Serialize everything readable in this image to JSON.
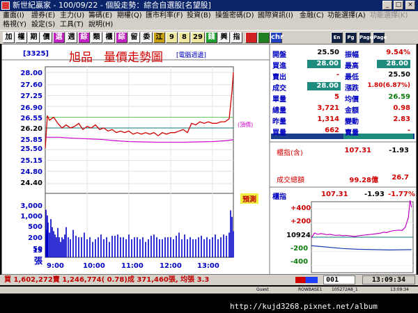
{
  "window": {
    "title": "新世紀贏家 - 100/09/22 - 個股走勢：綜合自選股[名望股]",
    "controls": [
      "_",
      "□",
      "×"
    ]
  },
  "menu": {
    "row1": [
      "畫面(I)",
      "證券(E)",
      "主力(U)",
      "籌碼(E)",
      "期權(Q)",
      "匯市利率(F)",
      "投資(B)",
      "操盤密碼(D)",
      "國際資訊(I)",
      "金融(C)",
      "功能選擇(A)",
      "功能選擇(K)"
    ],
    "row2": [
      "格視(Y)",
      "設定(S)",
      "工具(T)",
      "說明(H)"
    ]
  },
  "toolbar": {
    "buttons": [
      "加",
      "權",
      "期",
      "價",
      "選",
      "週",
      "綜",
      "類",
      "櫃",
      "綜",
      "留",
      "委",
      "江",
      "9",
      "8",
      "29",
      "錢",
      "興",
      "指",
      "",
      "",
      "chr",
      "En",
      "Pg",
      "Page",
      "Page"
    ]
  },
  "stock": {
    "code": "[3325]",
    "name": "旭品",
    "chart_title": "量價走勢圖",
    "tag": "[電腦週邊]",
    "annotation": "(頂價)",
    "volume_badge": "預測",
    "volume_unit": "張"
  },
  "chart_data": {
    "type": "line",
    "price_ticks": [
      "28.00",
      "27.60",
      "27.25",
      "26.90",
      "26.55",
      "26.20",
      "25.85",
      "25.50",
      "25.15",
      "24.80",
      "24.40"
    ],
    "volume_ticks": [
      "3,000",
      "1,000",
      "500",
      "200",
      "50",
      "15"
    ],
    "time_labels": [
      "9:00",
      "10:00",
      "11:00",
      "12:00",
      "13:00"
    ],
    "reference_price": 26.2,
    "limit_up": 28.0,
    "ylim": [
      24.4,
      28.0
    ],
    "price_series": {
      "x": [
        0,
        3,
        6,
        9,
        12,
        18,
        24,
        30,
        36,
        42,
        48,
        54,
        60,
        66,
        72,
        78,
        84,
        90,
        96,
        102,
        108,
        114,
        120,
        126,
        132,
        138,
        144,
        150,
        156,
        162,
        168,
        174,
        180,
        186,
        192,
        198,
        204,
        210,
        216,
        222,
        228,
        234,
        240,
        246,
        252,
        258,
        264,
        268,
        270
      ],
      "y": [
        25.55,
        26.6,
        26.45,
        26.5,
        26.55,
        26.35,
        26.2,
        26.3,
        26.2,
        26.25,
        26.35,
        26.15,
        26.25,
        26.2,
        26.3,
        26.15,
        26.2,
        26.1,
        26.15,
        26.05,
        26.1,
        26.05,
        26.1,
        26.0,
        26.05,
        26.0,
        26.05,
        26.0,
        26.05,
        25.95,
        26.05,
        26.0,
        26.05,
        26.05,
        26.1,
        26.15,
        26.05,
        26.35,
        26.3,
        26.4,
        26.35,
        26.4,
        26.35,
        26.35,
        26.4,
        26.4,
        26.5,
        27.4,
        28.0
      ]
    },
    "avg_series": {
      "x": [
        0,
        20,
        40,
        60,
        80,
        100,
        120,
        140,
        160,
        180,
        200,
        220,
        240,
        260,
        270
      ],
      "y": [
        25.9,
        25.9,
        25.87,
        25.85,
        25.83,
        25.79,
        25.76,
        25.75,
        25.74,
        25.74,
        25.74,
        25.75,
        25.76,
        25.79,
        25.82
      ]
    },
    "volume_series": {
      "x": [
        1,
        2,
        3,
        4,
        6,
        8,
        10,
        12,
        14,
        16,
        18,
        20,
        22,
        24,
        26,
        28,
        30,
        33,
        36,
        40,
        44,
        48,
        52,
        56,
        60,
        64,
        68,
        72,
        76,
        80,
        84,
        88,
        92,
        96,
        100,
        104,
        108,
        112,
        116,
        120,
        124,
        128,
        132,
        136,
        140,
        144,
        148,
        152,
        156,
        160,
        164,
        168,
        172,
        176,
        180,
        184,
        188,
        192,
        196,
        200,
        204,
        208,
        212,
        216,
        220,
        224,
        228,
        232,
        236,
        240,
        244,
        248,
        252,
        256,
        260,
        264,
        266,
        268,
        270
      ],
      "y": [
        1200,
        60,
        520,
        180,
        40,
        300,
        90,
        50,
        30,
        20,
        80,
        20,
        10,
        20,
        15,
        30,
        90,
        20,
        15,
        60,
        25,
        20,
        20,
        40,
        15,
        20,
        10,
        15,
        20,
        30,
        15,
        20,
        10,
        25,
        25,
        30,
        20,
        20,
        15,
        30,
        15,
        20,
        20,
        15,
        20,
        10,
        15,
        25,
        30,
        20,
        15,
        15,
        20,
        20,
        20,
        15,
        25,
        40,
        15,
        30,
        15,
        20,
        15,
        15,
        20,
        25,
        15,
        20,
        15,
        20,
        30,
        15,
        20,
        30,
        25,
        40,
        1100,
        420,
        50
      ]
    },
    "futures_ticks": [
      "+400",
      "+200",
      "10924",
      "-200",
      "-400"
    ],
    "futures_series": {
      "x": [
        0,
        4,
        8,
        12,
        16,
        20,
        24,
        28,
        32,
        36,
        40,
        44,
        48,
        52,
        56,
        60,
        64,
        68,
        72,
        76,
        80,
        84,
        88,
        92,
        96,
        100,
        104,
        108,
        112,
        116,
        120,
        124,
        126,
        128
      ],
      "y": [
        -10,
        60,
        40,
        50,
        45,
        35,
        40,
        30,
        25,
        30,
        20,
        25,
        20,
        15,
        10,
        20,
        25,
        30,
        35,
        40,
        45,
        50,
        55,
        70,
        65,
        80,
        90,
        95,
        100,
        95,
        140,
        280,
        520,
        420
      ]
    },
    "futures_base": {
      "x": [
        0,
        20,
        40,
        60,
        80,
        100,
        128
      ],
      "y": [
        -120,
        -140,
        -160,
        -170,
        -175,
        -180,
        -175
      ]
    }
  },
  "quotes": {
    "rows": [
      {
        "l1": "開盤",
        "v1": "25.50",
        "l2": "振幅",
        "v2": "9.54%",
        "c1": "#000000",
        "c2": "#d00000",
        "box1": false,
        "box2": false
      },
      {
        "l1": "買進",
        "v1": "28.00",
        "l2": "最高",
        "v2": "28.00",
        "c1": "#ffffff",
        "c2": "#ffffff",
        "box1": true,
        "box2": true
      },
      {
        "l1": "賣出",
        "v1": "-",
        "l2": "最低",
        "v2": "25.50",
        "c1": "#d00000",
        "c2": "#000000",
        "box1": false,
        "box2": false
      },
      {
        "l1": "成交",
        "v1": "28.00",
        "l2": "漲跌",
        "v2": "1.80(6.87%)",
        "c1": "#ffffff",
        "c2": "#d00000",
        "box1": true,
        "box2": false
      },
      {
        "l1": "單量",
        "v1": "5",
        "l2": "均價",
        "v2": "26.59",
        "c1": "#d00000",
        "c2": "#0a7a0a",
        "box1": false,
        "box2": false
      },
      {
        "l1": "總量",
        "v1": "3,721",
        "l2": "金額",
        "v2": "0.98",
        "c1": "#d00000",
        "c2": "#d00000",
        "box1": false,
        "box2": false
      },
      {
        "l1": "昨量",
        "v1": "1,314",
        "l2": "變動",
        "v2": "2.83",
        "c1": "#d00000",
        "c2": "#d00000",
        "box1": false,
        "box2": false
      },
      {
        "l1": "買量",
        "v1": "662",
        "l2": "賣量",
        "v2": "-",
        "c1": "#d00000",
        "c2": "#d00000",
        "box1": false,
        "box2": false
      }
    ],
    "index_label": "櫃指(含)",
    "index_value": "107.31",
    "index_change": "-1.93",
    "turnover_label": "成交總額",
    "turnover_value": "99.28億",
    "turnover_extra": "26.7",
    "mini_label": "櫃指",
    "mini_value": "107.31",
    "mini_change": "-1.93",
    "mini_pct": "-1.77%"
  },
  "status": {
    "text": "買 1,602,272賣 1,246,774( 0.78)成 371,460張, 均張 3.3",
    "code_field": "001",
    "time": "13:09:34"
  },
  "taskbar": {
    "items": [
      "Guest",
      "ROWBASE1",
      "105272A8_1",
      "13:09:34"
    ],
    "url": "http://kujd3268.pixnet.net/album"
  },
  "colors": {
    "price_line": "#d00000",
    "avg_line": "#d000d0",
    "volume_bar": "#0000c8",
    "reference_line": "#0a7a7a",
    "limit_line": "#5ec85e",
    "title_red": "#d00000",
    "quote_box": "#1f8a7e"
  }
}
